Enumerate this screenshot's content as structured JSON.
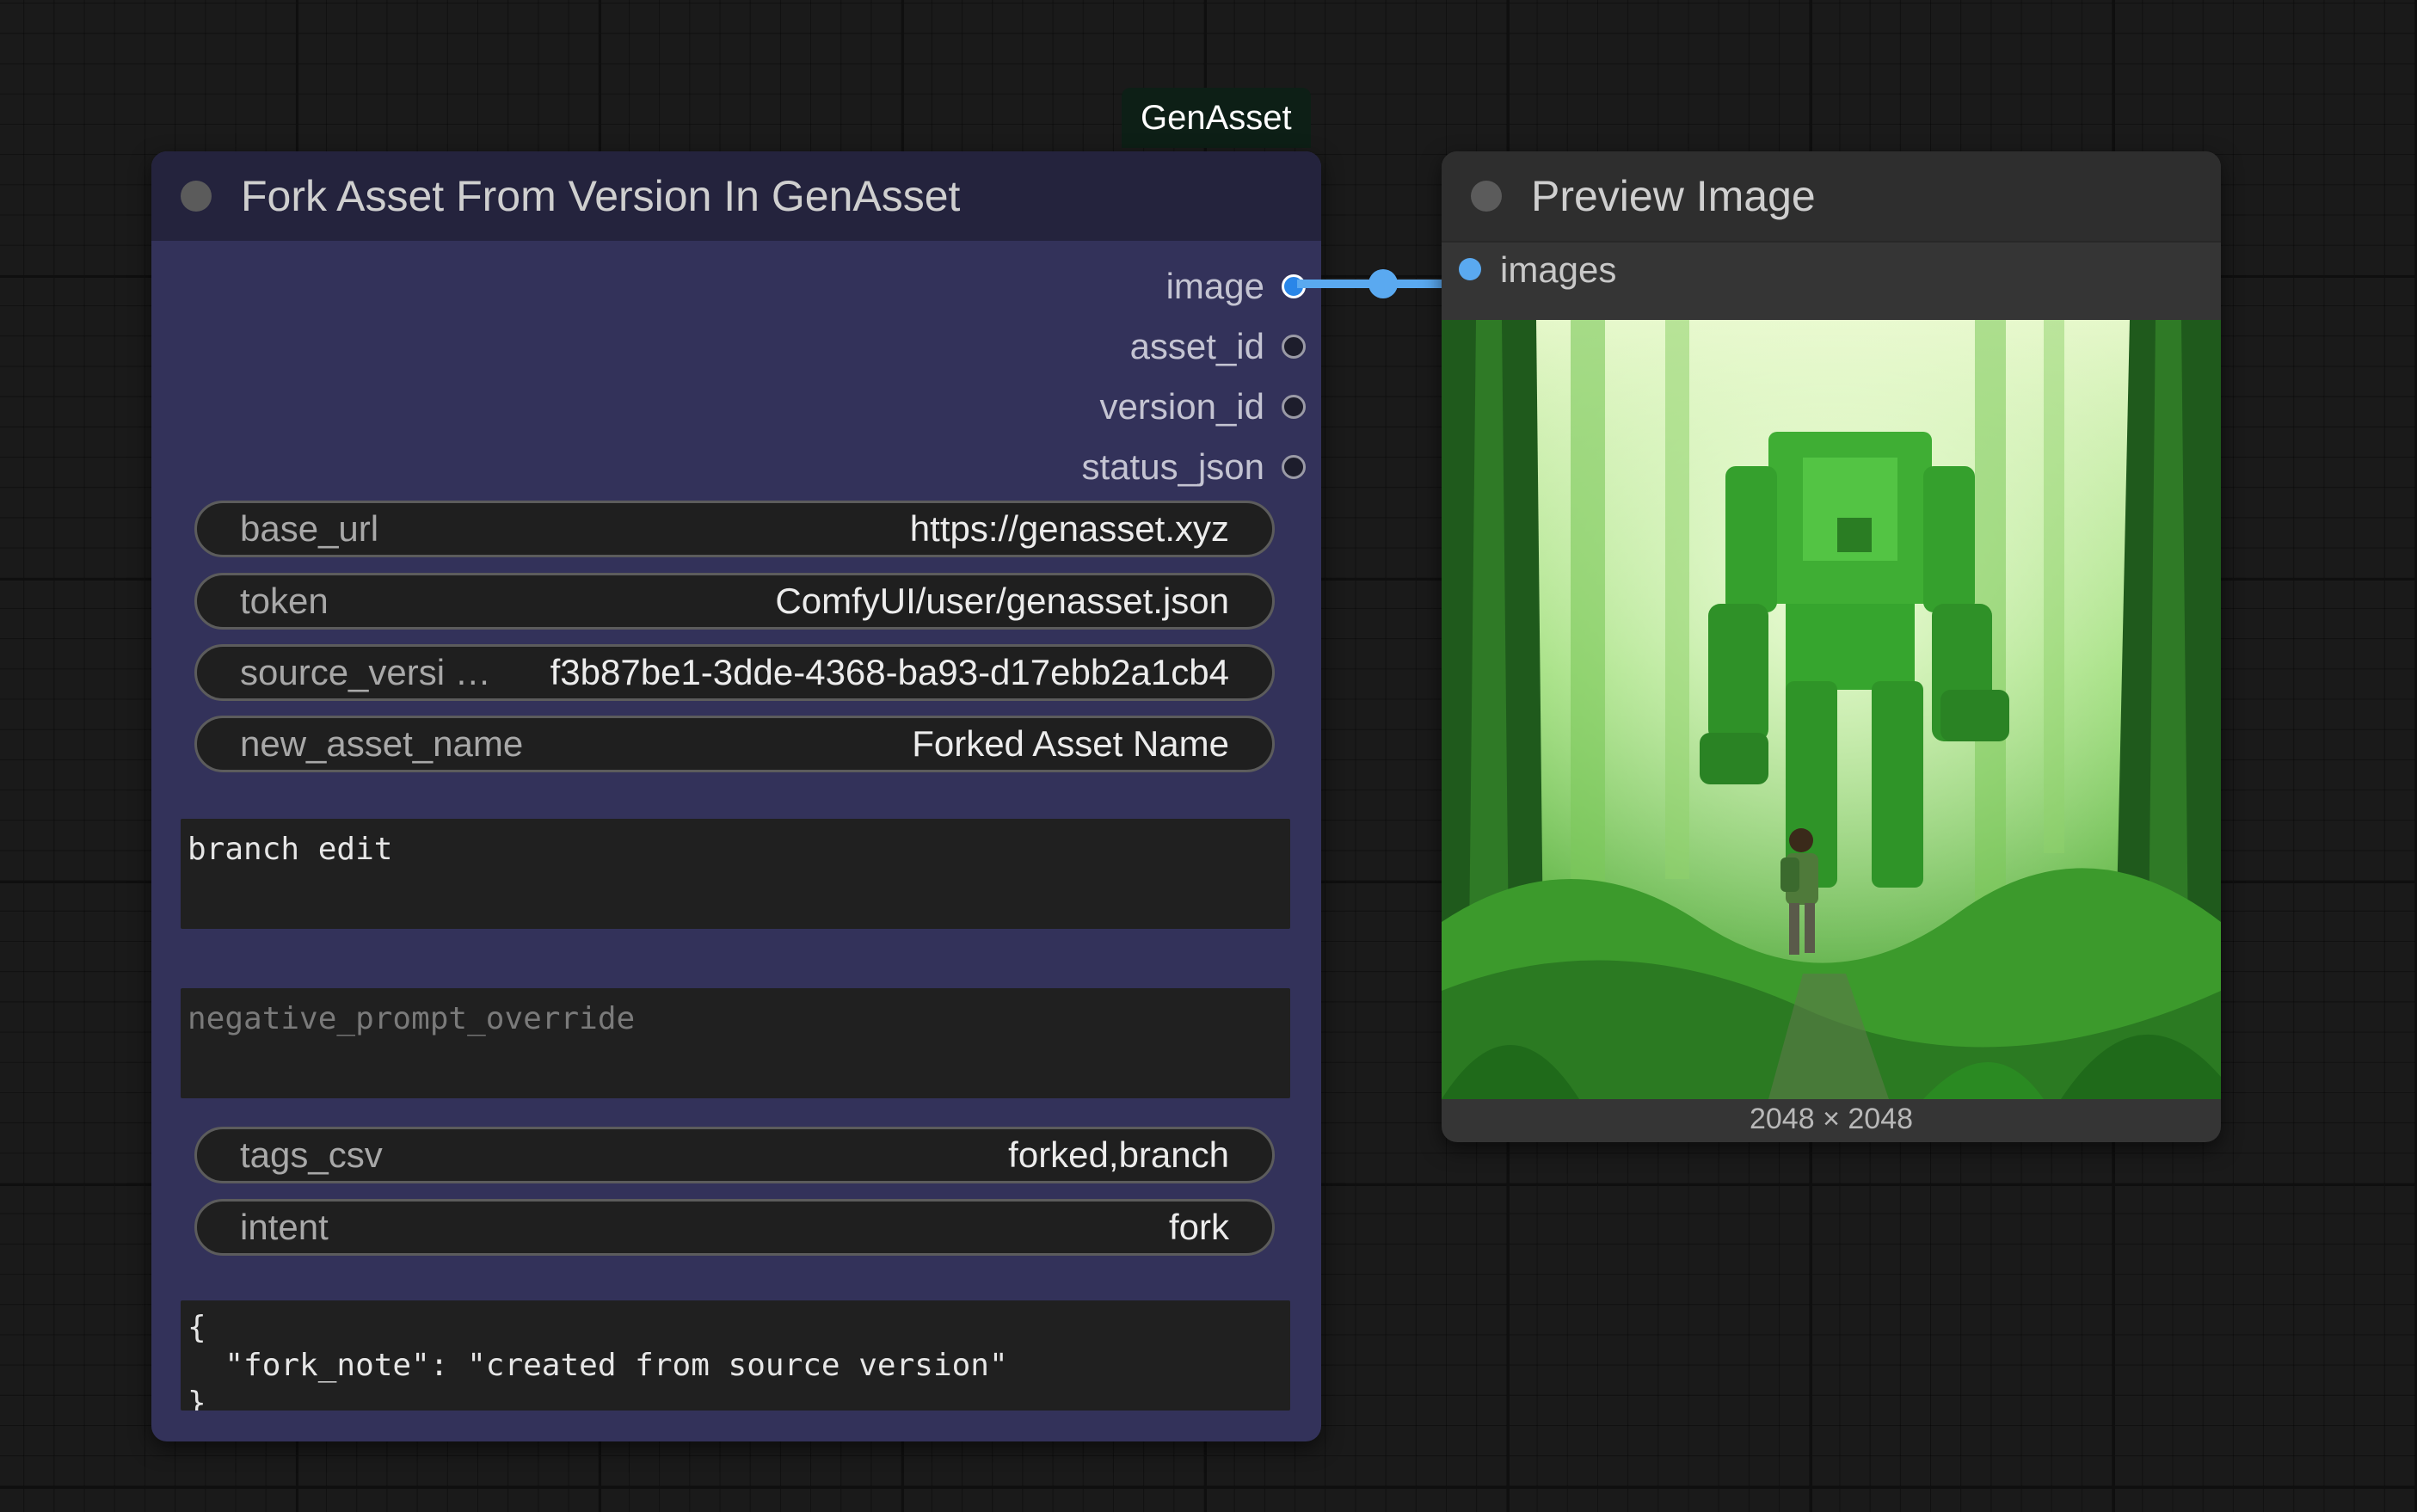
{
  "group": {
    "label": "GenAsset"
  },
  "fork_node": {
    "title": "Fork Asset From Version In GenAsset",
    "outputs": [
      {
        "label": "image",
        "connected": true
      },
      {
        "label": "asset_id",
        "connected": false
      },
      {
        "label": "version_id",
        "connected": false
      },
      {
        "label": "status_json",
        "connected": false
      }
    ],
    "widgets": {
      "base_url": {
        "label": "base_url",
        "value": "https://genasset.xyz"
      },
      "token": {
        "label": "token",
        "value": "ComfyUI/user/genasset.json"
      },
      "source_version": {
        "label": "source_versi …",
        "value": "f3b87be1-3dde-4368-ba93-d17ebb2a1cb4"
      },
      "new_asset_name": {
        "label": "new_asset_name",
        "value": "Forked Asset Name"
      },
      "tags_csv": {
        "label": "tags_csv",
        "value": "forked,branch"
      },
      "intent": {
        "label": "intent",
        "value": "fork"
      }
    },
    "textareas": {
      "edit_prompt": {
        "value": "branch edit"
      },
      "negative_prompt_override": {
        "placeholder": "negative_prompt_override"
      },
      "metadata_json": {
        "value": "{\n  \"fork_note\": \"created from source version\"\n}"
      }
    }
  },
  "preview_node": {
    "title": "Preview Image",
    "input_label": "images",
    "image_caption": "2048 × 2048",
    "image_subject": "green forest robot with explorer"
  },
  "colors": {
    "fork_node_body": "#33325a",
    "fork_node_header": "#24233d",
    "preview_node_body": "#353535",
    "link": "#5aa9f0",
    "canvas": "#1a1a1a"
  }
}
